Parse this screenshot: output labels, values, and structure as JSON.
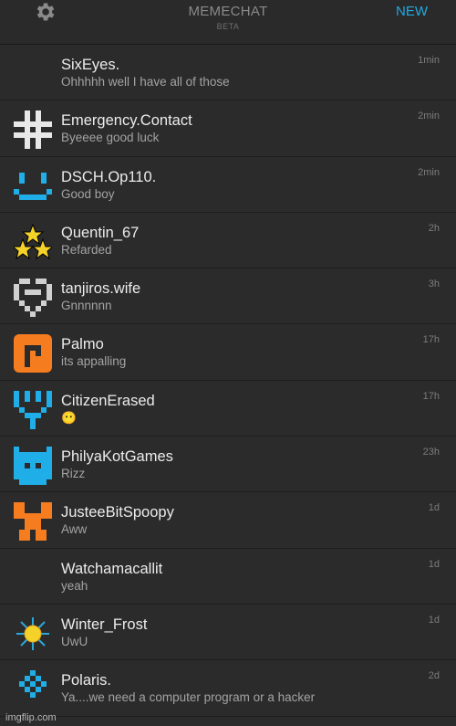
{
  "header": {
    "title": "MEMECHAT",
    "subtitle": "BETA",
    "new_label": "NEW",
    "settings_icon": "gear-icon"
  },
  "colors": {
    "accent": "#21a9e1",
    "background": "#2b2b2b",
    "orange": "#f57c1f",
    "blue": "#1faee8"
  },
  "chats": [
    {
      "name": "SixEyes.",
      "message": "Ohhhhh well I have all of those",
      "time": "1min",
      "avatar": "none"
    },
    {
      "name": "Emergency.Contact",
      "message": "Byeeee good luck",
      "time": "2min",
      "avatar": "white-cross-pixel-icon"
    },
    {
      "name": "DSCH.Op110.",
      "message": "Good boy",
      "time": "2min",
      "avatar": "blue-smile-pixel-icon"
    },
    {
      "name": "Quentin_67",
      "message": "Refarded",
      "time": "2h",
      "avatar": "three-stars-icon"
    },
    {
      "name": "tanjiros.wife",
      "message": "Gnnnnnn",
      "time": "3h",
      "avatar": "white-heart-pixel-icon"
    },
    {
      "name": "Palmo",
      "message": "its appalling",
      "time": "17h",
      "avatar": "orange-p-pixel-icon"
    },
    {
      "name": "CitizenErased",
      "message": "😶",
      "time": "17h",
      "avatar": "blue-y-pixel-icon"
    },
    {
      "name": "PhilyaKotGames",
      "message": "Rizz",
      "time": "23h",
      "avatar": "blue-cat-pixel-icon"
    },
    {
      "name": "JusteeBitSpoopy",
      "message": "Aww",
      "time": "1d",
      "avatar": "orange-totem-pixel-icon"
    },
    {
      "name": "Watchamacallit",
      "message": "yeah",
      "time": "1d",
      "avatar": "none"
    },
    {
      "name": "Winter_Frost",
      "message": "UwU",
      "time": "1d",
      "avatar": "sun-icon"
    },
    {
      "name": "Polaris.",
      "message": "Ya....we need a computer program or a hacker",
      "time": "2d",
      "avatar": "blue-diamond-pixel-icon"
    }
  ],
  "watermark": "imgflip.com"
}
